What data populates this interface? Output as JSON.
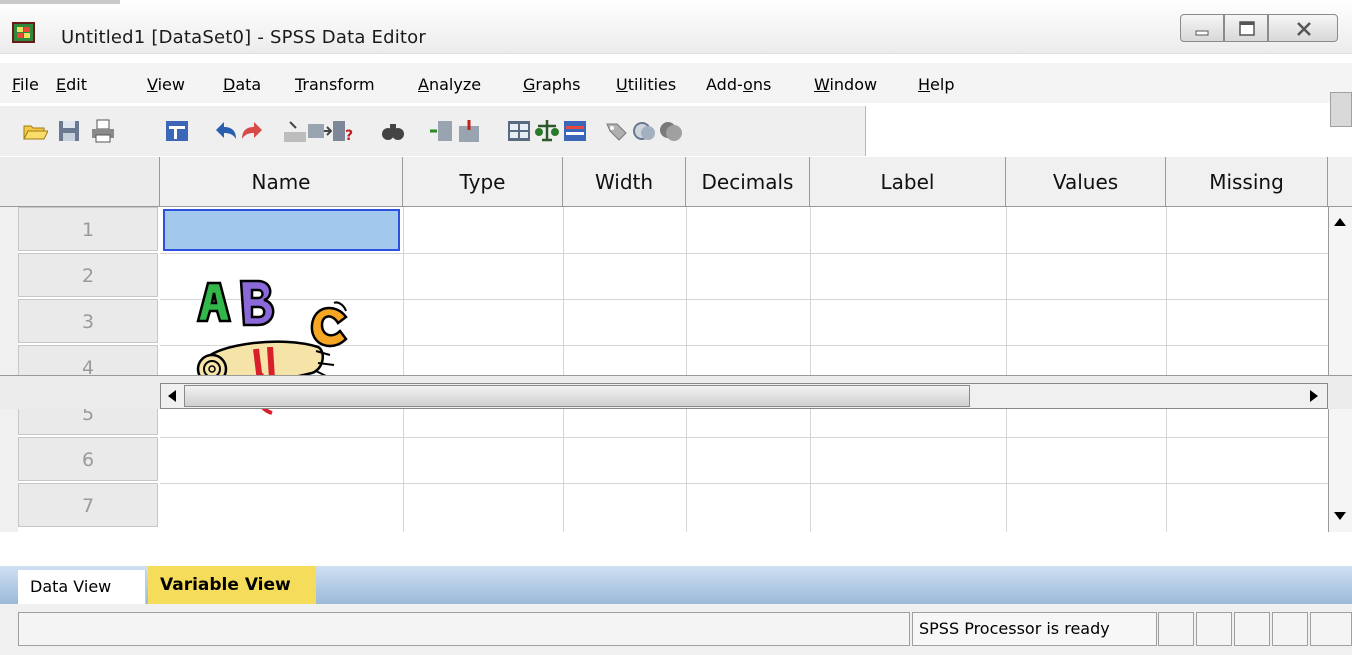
{
  "window": {
    "title": "Untitled1 [DataSet0] - SPSS Data Editor",
    "icon": "spss-grid-icon"
  },
  "menu": [
    {
      "label": "File",
      "accel": "F"
    },
    {
      "label": "Edit",
      "accel": "E"
    },
    {
      "label": "View",
      "accel": "V"
    },
    {
      "label": "Data",
      "accel": "D"
    },
    {
      "label": "Transform",
      "accel": "T"
    },
    {
      "label": "Analyze",
      "accel": "A"
    },
    {
      "label": "Graphs",
      "accel": "G"
    },
    {
      "label": "Utilities",
      "accel": "U"
    },
    {
      "label": "Add-ons",
      "accel": "o"
    },
    {
      "label": "Window",
      "accel": "W"
    },
    {
      "label": "Help",
      "accel": "H"
    }
  ],
  "toolbar": {
    "icons": [
      "open-folder-icon",
      "save-icon",
      "print-icon",
      "dialog-recall-icon",
      "undo-icon",
      "redo-icon",
      "goto-case-icon",
      "goto-variable-icon",
      "variables-icon",
      "find-icon",
      "insert-cases-icon",
      "insert-variable-icon",
      "split-file-icon",
      "weight-cases-icon",
      "select-cases-icon",
      "value-labels-icon",
      "use-sets-icon",
      "show-all-variables-icon"
    ]
  },
  "grid": {
    "columns": [
      "Name",
      "Type",
      "Width",
      "Decimals",
      "Label",
      "Values",
      "Missing"
    ],
    "rows": [
      "1",
      "2",
      "3",
      "4",
      "5",
      "6",
      "7"
    ],
    "selected": {
      "row": "1",
      "column": "Name"
    }
  },
  "clipart": "abc-scroll-clipart",
  "tabs": {
    "data_view": "Data View",
    "variable_view": "Variable View",
    "active": "Variable View"
  },
  "status": {
    "text": "SPSS  Processor is ready"
  },
  "colors": {
    "selection": "#a3c8ee",
    "selection_border": "#2c50e0",
    "active_tab": "#f5dc5a",
    "tab_bar": "#9bbad9"
  }
}
